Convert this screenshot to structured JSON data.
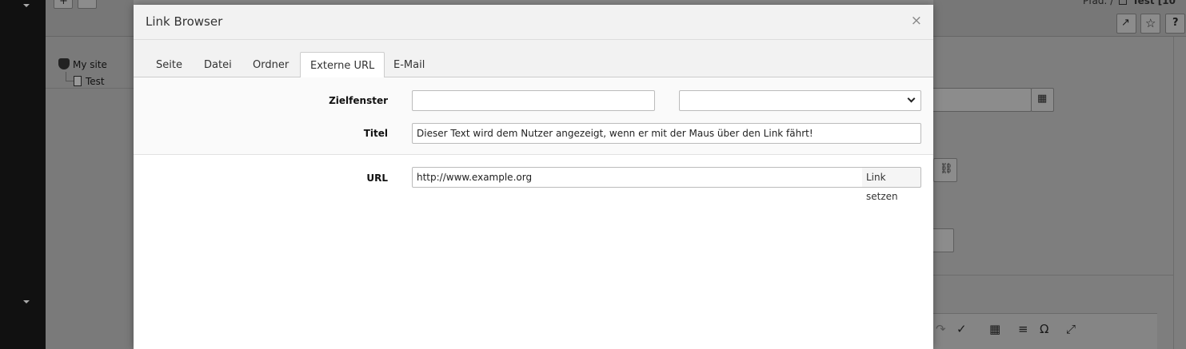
{
  "background": {
    "tree": {
      "root": "My site",
      "child": "Test"
    },
    "breadcrumb": "Pfad: /",
    "page_ref": "Test [10"
  },
  "modal": {
    "title": "Link Browser",
    "close": "×"
  },
  "tabs": [
    {
      "label": "Seite",
      "active": false
    },
    {
      "label": "Datei",
      "active": false
    },
    {
      "label": "Ordner",
      "active": false
    },
    {
      "label": "Externe URL",
      "active": true
    },
    {
      "label": "E-Mail",
      "active": false
    }
  ],
  "form": {
    "target_label": "Zielfenster",
    "target_value": "",
    "target_select_value": "",
    "title_label": "Titel",
    "title_value": "Dieser Text wird dem Nutzer angezeigt, wenn er mit der Maus über den Link fährt!",
    "url_label": "URL",
    "url_value": "http://www.example.org",
    "set_link_label": "Link setzen"
  },
  "colors": {
    "overlay": "#8a8a8a",
    "modal_bg": "#ffffff",
    "header_bg": "#f2f2f2",
    "border": "#cccccc"
  }
}
